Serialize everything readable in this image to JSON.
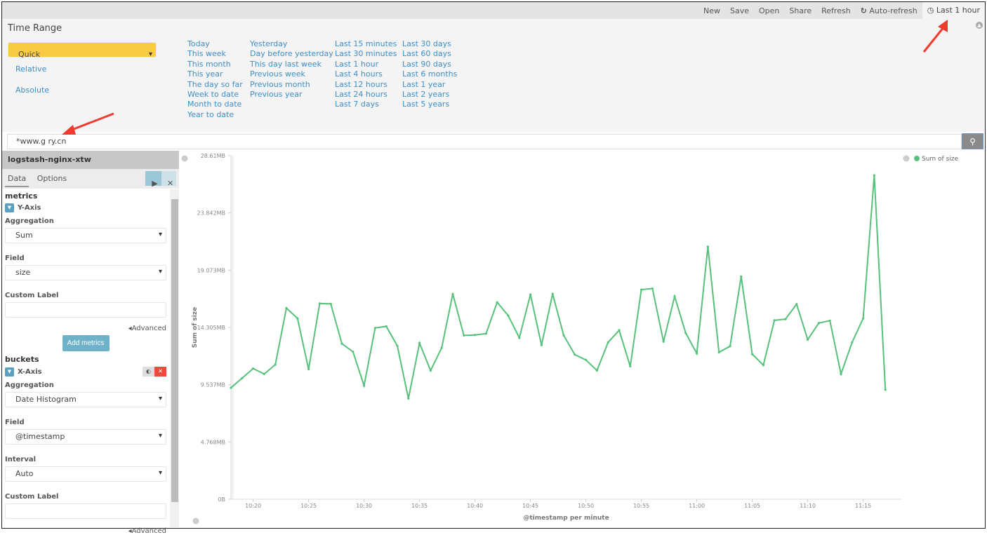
{
  "topbar": {
    "items": [
      "New",
      "Save",
      "Open",
      "Share",
      "Refresh",
      "Auto-refresh"
    ],
    "time": "Last 1 hour",
    "auto_icon": "refresh-icon",
    "time_icon": "clock-icon"
  },
  "time_range": {
    "title": "Time Range",
    "modes": [
      "Quick",
      "Relative",
      "Absolute"
    ],
    "selected": "Quick",
    "columns": [
      [
        "Today",
        "This week",
        "This month",
        "This year",
        "The day so far",
        "Week to date",
        "Month to date",
        "Year to date"
      ],
      [
        "Yesterday",
        "Day before yesterday",
        "This day last week",
        "Previous week",
        "Previous month",
        "Previous year"
      ],
      [
        "Last 15 minutes",
        "Last 30 minutes",
        "Last 1 hour",
        "Last 4 hours",
        "Last 12 hours",
        "Last 24 hours",
        "Last 7 days"
      ],
      [
        "Last 30 days",
        "Last 60 days",
        "Last 90 days",
        "Last 6 months",
        "Last 1 year",
        "Last 2 years",
        "Last 5 years"
      ]
    ]
  },
  "search": {
    "value": "*www.g      ry.cn"
  },
  "sidebar": {
    "index": "logstash-nginx-xtw",
    "tabs": [
      "Data",
      "Options"
    ],
    "metrics": {
      "title": "metrics",
      "axis": "Y-Axis",
      "agg_label": "Aggregation",
      "agg": "Sum",
      "field_label": "Field",
      "field": "size",
      "custom_label": "Custom Label",
      "advanced": "Advanced",
      "add": "Add metrics"
    },
    "buckets": {
      "title": "buckets",
      "axis": "X-Axis",
      "agg_label": "Aggregation",
      "agg": "Date Histogram",
      "field_label": "Field",
      "field": "@timestamp",
      "interval_label": "Interval",
      "interval": "Auto",
      "custom_label": "Custom Label",
      "advanced": "Advanced"
    }
  },
  "chart_data": {
    "type": "line",
    "xlabel": "@timestamp per minute",
    "ylabel": "Sum of size",
    "legend": "Sum of size",
    "legend_position": "top-right",
    "color": "#57c17b",
    "ylim": [
      0,
      28.61
    ],
    "y_unit": "MB",
    "yticks": [
      "0B",
      "4.768MB",
      "9.537MB",
      "14.305MB",
      "19.073MB",
      "23.842MB",
      "28.61MB"
    ],
    "xticks": [
      "10:20",
      "10:25",
      "10:30",
      "10:35",
      "10:40",
      "10:45",
      "10:50",
      "10:55",
      "11:00",
      "11:05",
      "11:10",
      "11:15"
    ],
    "x": [
      "10:18",
      "10:19",
      "10:20",
      "10:21",
      "10:22",
      "10:23",
      "10:24",
      "10:25",
      "10:26",
      "10:27",
      "10:28",
      "10:29",
      "10:30",
      "10:31",
      "10:32",
      "10:33",
      "10:34",
      "10:35",
      "10:36",
      "10:37",
      "10:38",
      "10:39",
      "10:40",
      "10:41",
      "10:42",
      "10:43",
      "10:44",
      "10:45",
      "10:46",
      "10:47",
      "10:48",
      "10:49",
      "10:50",
      "10:51",
      "10:52",
      "10:53",
      "10:54",
      "10:55",
      "10:56",
      "10:57",
      "10:58",
      "10:59",
      "11:00",
      "11:01",
      "11:02",
      "11:03",
      "11:04",
      "11:05",
      "11:06",
      "11:07",
      "11:08",
      "11:09",
      "11:10",
      "11:11",
      "11:12",
      "11:13",
      "11:14",
      "11:15",
      "11:16",
      "11:17"
    ],
    "values": [
      9.28,
      10.08,
      10.88,
      10.43,
      11.21,
      15.92,
      15.06,
      10.82,
      16.3,
      16.27,
      12.96,
      12.28,
      9.46,
      14.26,
      14.4,
      12.77,
      8.39,
      13.0,
      10.72,
      12.61,
      17.09,
      13.64,
      13.68,
      13.79,
      16.4,
      15.29,
      13.44,
      17.05,
      12.83,
      17.1,
      13.64,
      12.04,
      11.6,
      10.72,
      13.06,
      14.07,
      11.07,
      17.45,
      17.55,
      13.12,
      16.89,
      13.84,
      12.14,
      21.03,
      12.24,
      12.74,
      18.55,
      12.08,
      11.17,
      14.9,
      15.0,
      16.25,
      13.29,
      14.67,
      14.87,
      10.43,
      13.06,
      15.06,
      26.97,
      9.12
    ]
  }
}
